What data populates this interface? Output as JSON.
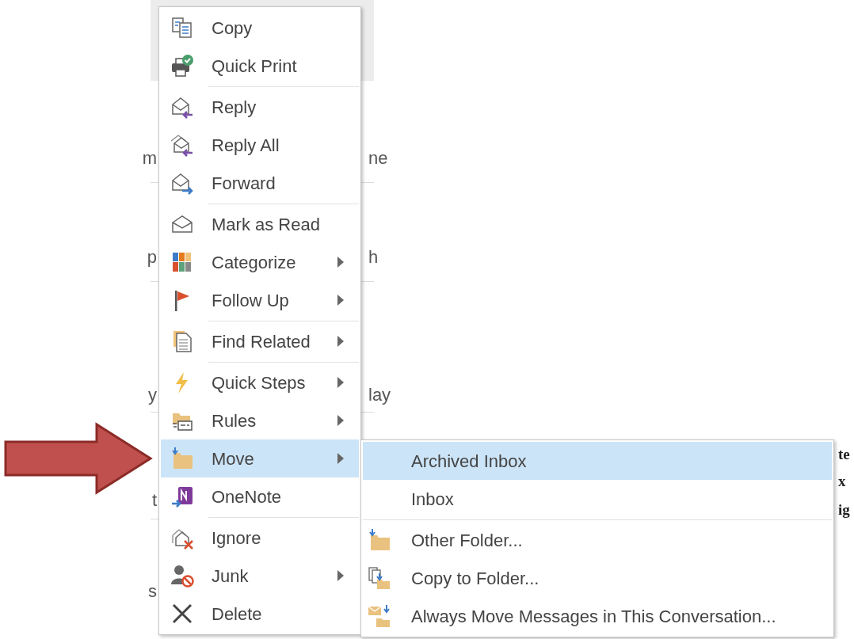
{
  "background_fragments": [
    {
      "text": "m",
      "kind": "sans"
    },
    {
      "text": "ne",
      "kind": "sans"
    },
    {
      "text": "p",
      "kind": "sans"
    },
    {
      "text": "h",
      "kind": "sans"
    },
    {
      "text": "y",
      "kind": "sans"
    },
    {
      "text": "lay",
      "kind": "sans"
    },
    {
      "text": "t",
      "kind": "sans"
    },
    {
      "text": "s",
      "kind": "sans"
    },
    {
      "text": "te",
      "kind": "serif"
    },
    {
      "text": "x",
      "kind": "serif"
    },
    {
      "text": "ig",
      "kind": "serif"
    }
  ],
  "context_menu": {
    "groups": [
      {
        "items": [
          {
            "label": "Copy",
            "has_submenu": false,
            "selected": false
          },
          {
            "label": "Quick Print",
            "has_submenu": false,
            "selected": false
          }
        ]
      },
      {
        "items": [
          {
            "label": "Reply",
            "has_submenu": false,
            "selected": false
          },
          {
            "label": "Reply All",
            "has_submenu": false,
            "selected": false
          },
          {
            "label": "Forward",
            "has_submenu": false,
            "selected": false
          }
        ]
      },
      {
        "items": [
          {
            "label": "Mark as Read",
            "has_submenu": false,
            "selected": false
          },
          {
            "label": "Categorize",
            "has_submenu": true,
            "selected": false
          },
          {
            "label": "Follow Up",
            "has_submenu": true,
            "selected": false
          }
        ]
      },
      {
        "items": [
          {
            "label": "Find Related",
            "has_submenu": true,
            "selected": false
          }
        ]
      },
      {
        "items": [
          {
            "label": "Quick Steps",
            "has_submenu": true,
            "selected": false
          },
          {
            "label": "Rules",
            "has_submenu": true,
            "selected": false
          },
          {
            "label": "Move",
            "has_submenu": true,
            "selected": true
          },
          {
            "label": "OneNote",
            "has_submenu": false,
            "selected": false
          }
        ]
      },
      {
        "items": [
          {
            "label": "Ignore",
            "has_submenu": false,
            "selected": false
          },
          {
            "label": "Junk",
            "has_submenu": true,
            "selected": false
          },
          {
            "label": "Delete",
            "has_submenu": false,
            "selected": false
          }
        ]
      }
    ]
  },
  "move_submenu": {
    "groups": [
      {
        "items": [
          {
            "label": "Archived Inbox",
            "selected": true
          },
          {
            "label": "Inbox",
            "selected": false
          }
        ]
      },
      {
        "items": [
          {
            "label": "Other Folder...",
            "selected": false
          },
          {
            "label": "Copy to Folder...",
            "selected": false
          },
          {
            "label": "Always Move Messages in This Conversation...",
            "selected": false
          }
        ]
      }
    ]
  }
}
